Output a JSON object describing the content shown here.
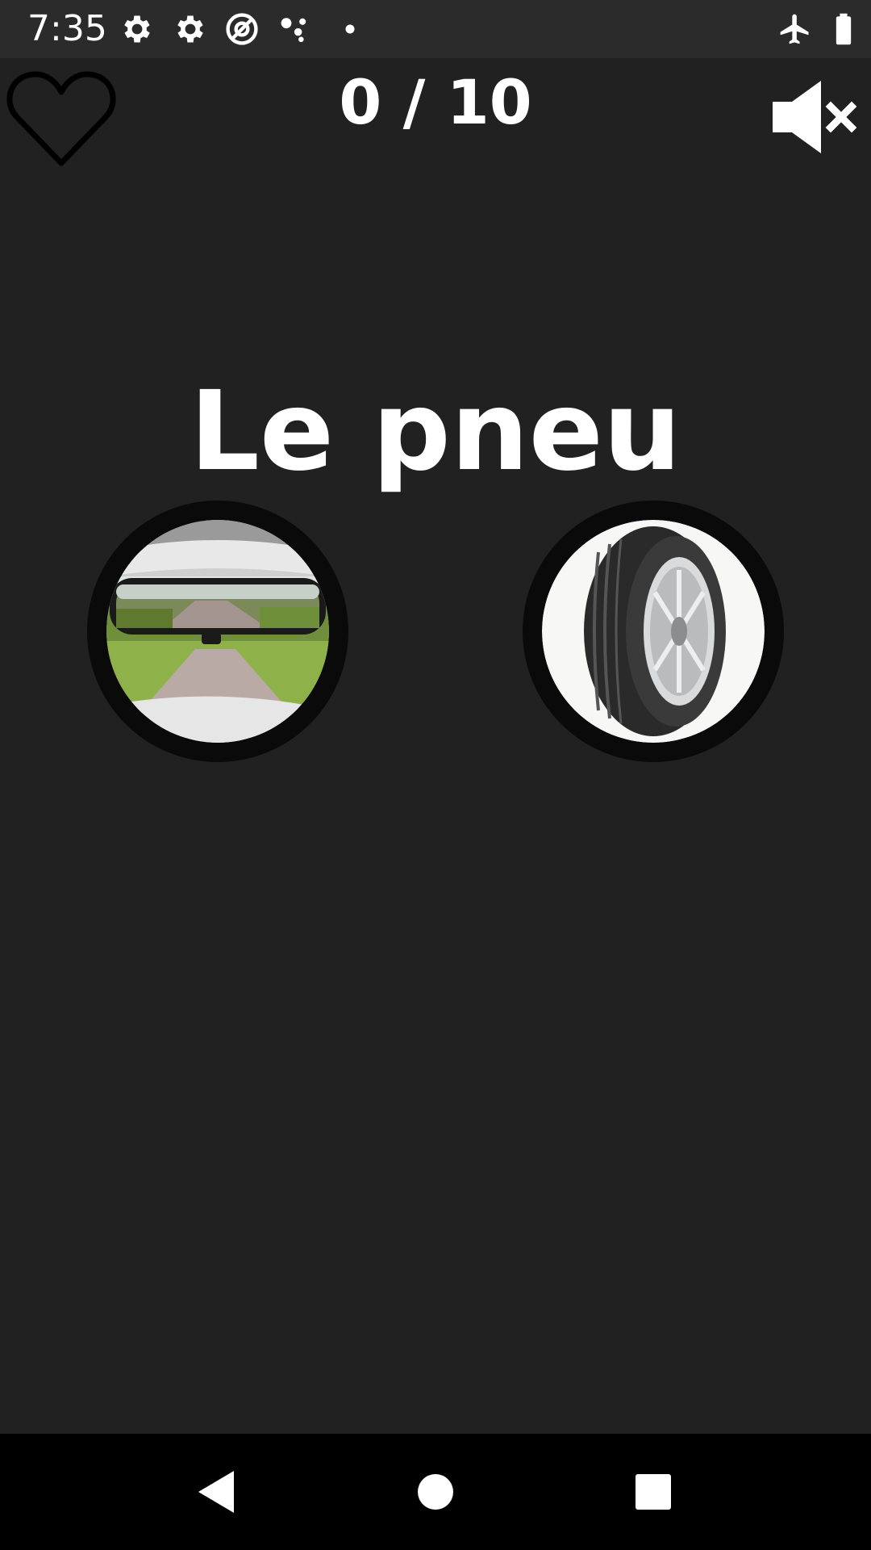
{
  "status_bar": {
    "time": "7:35",
    "left_icons": [
      "settings-icon",
      "settings-icon",
      "at-sign-icon",
      "dots-icon",
      "dot-icon"
    ],
    "right_icons": [
      "airplane-mode-icon",
      "battery-icon"
    ]
  },
  "header": {
    "favorite_icon": "heart-outline-icon",
    "score": "0 / 10",
    "sound_icon": "volume-muted-icon"
  },
  "question": {
    "word": "Le pneu"
  },
  "choices": [
    {
      "id": "choice-1",
      "image": "rearview-mirror"
    },
    {
      "id": "choice-2",
      "image": "tire"
    }
  ],
  "navigation": {
    "back_icon": "back-triangle-icon",
    "home_icon": "home-circle-icon",
    "recents_icon": "recents-square-icon"
  },
  "colors": {
    "background": "#212121",
    "status_bar": "#2b2b2b",
    "nav_bar": "#000000",
    "text": "#ffffff"
  }
}
